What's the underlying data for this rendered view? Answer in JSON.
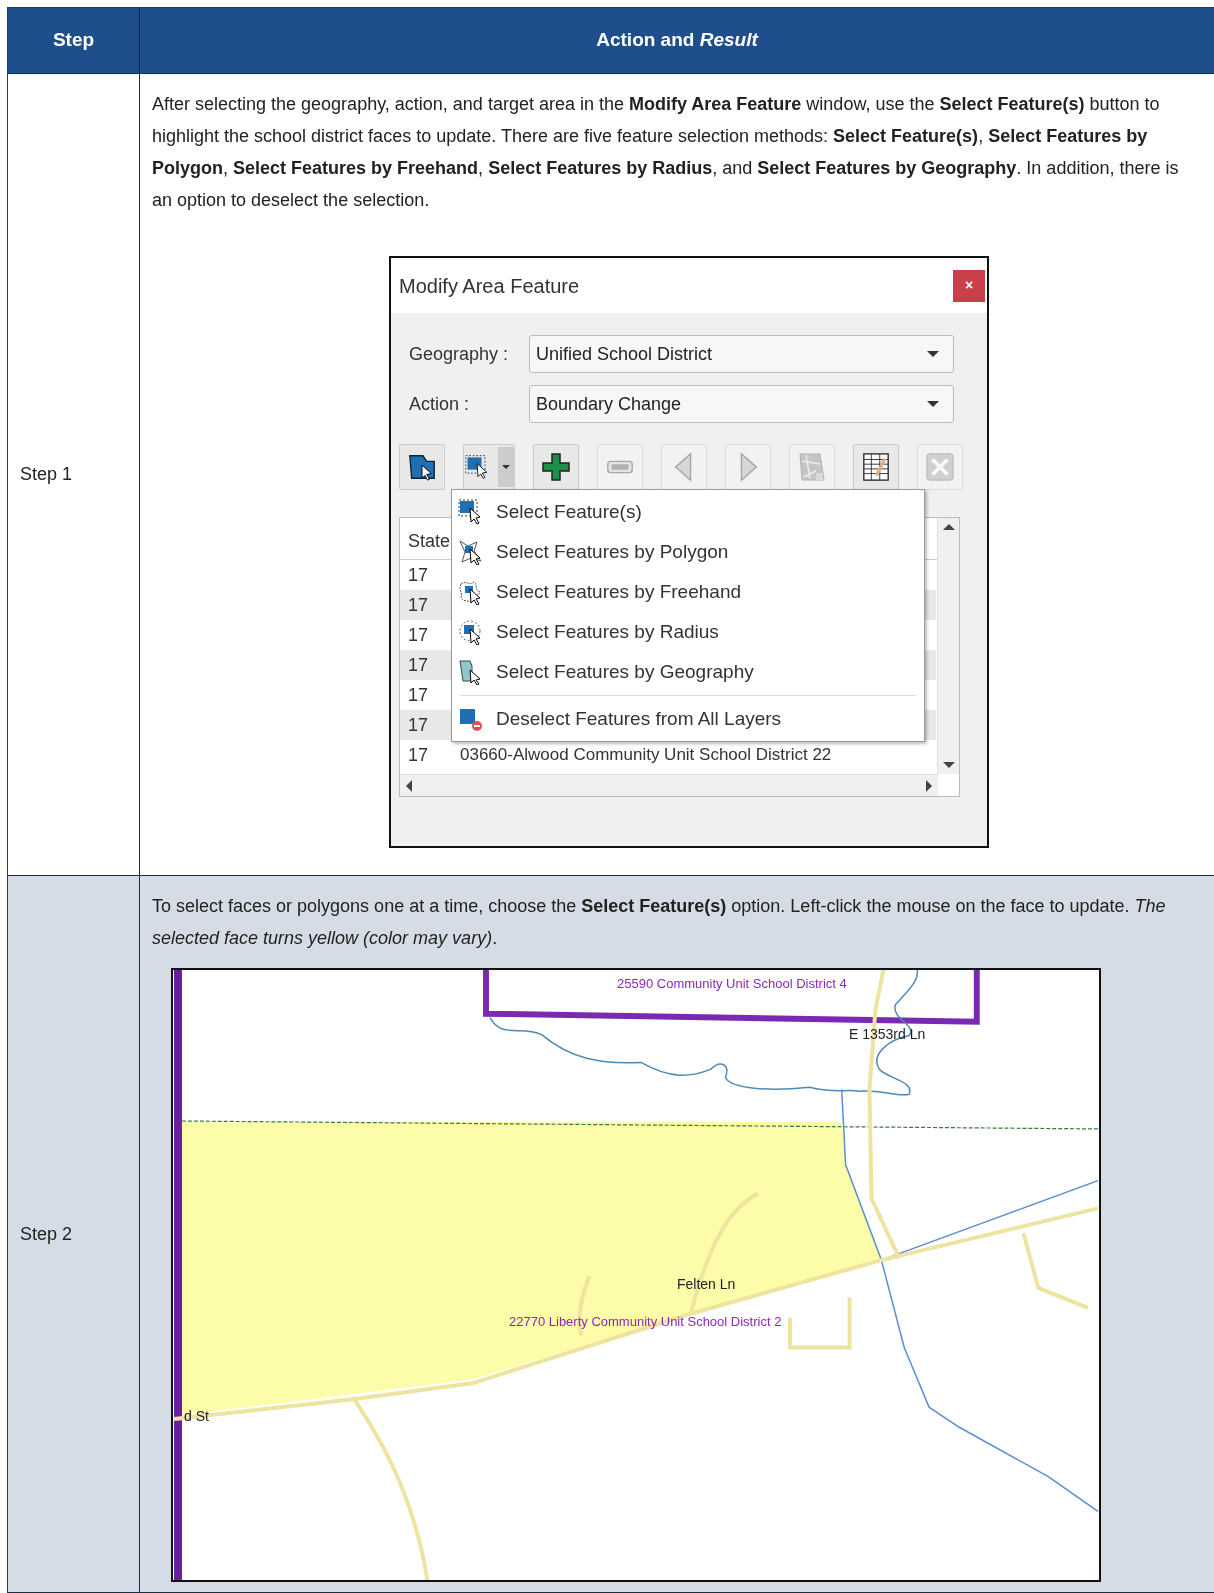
{
  "table": {
    "columns": [
      "Step",
      "Action and *Result*"
    ],
    "rows": [
      {
        "step": "Step 1",
        "text": "After selecting the geography, action, and target area in the **Modify Area Feature** window, use the **Select Feature(s)** button to highlight the school district faces to update. There are five feature selection methods: **Select Feature(s)**, **Select Features by Polygon**, **Select Features by Freehand**, **Select Features by Radius**, and **Select Features by Geography**. In addition, there is an option to deselect the selection.",
        "figure": {
          "kind": "dialog",
          "title": "Modify Area Feature",
          "close": "×",
          "fields": [
            {
              "label": "Geography :",
              "value": "Unified School District"
            },
            {
              "label": "Action :",
              "value": "Boundary Change"
            }
          ],
          "toolbar": [
            {
              "kind": "geo",
              "disabled": false
            },
            {
              "kind": "select",
              "disabled": false
            },
            {
              "kind": "add",
              "disabled": false
            },
            {
              "kind": "remove",
              "disabled": true
            },
            {
              "kind": "prev",
              "disabled": true
            },
            {
              "kind": "next",
              "disabled": true
            },
            {
              "kind": "map",
              "disabled": true
            },
            {
              "kind": "table",
              "disabled": false
            },
            {
              "kind": "clear",
              "disabled": true
            }
          ],
          "menu": [
            {
              "kind": "select",
              "label": "Select Feature(s)"
            },
            {
              "kind": "polygon",
              "label": "Select Features by Polygon"
            },
            {
              "kind": "freehand",
              "label": "Select Features by Freehand"
            },
            {
              "kind": "radius",
              "label": "Select Features by Radius"
            },
            {
              "kind": "geography",
              "label": "Select Features by Geography"
            },
            {
              "kind": "deselect",
              "label": "Deselect Features from All Layers"
            }
          ],
          "grid": {
            "column_1": "State",
            "rows": [
              {
                "column_1": "17"
              },
              {
                "column_1": "17"
              },
              {
                "column_1": "17"
              },
              {
                "column_1": "17"
              },
              {
                "column_1": "17"
              },
              {
                "column_1": "17"
              },
              {
                "column_1": "17",
                "column_2": "03660-Alwood Community Unit School District 22"
              }
            ]
          }
        }
      },
      {
        "step": "Step 2",
        "text": "To select faces or polygons one at a time, choose the **Select Feature(s)** option. Left-click the mouse on the face to update. *The selected face turns yellow (color may vary)*.",
        "figure": {
          "kind": "map",
          "labels": [
            {
              "kind": "district",
              "text": "25590 Community Unit School District 4"
            },
            {
              "kind": "road",
              "text": "E 1353rd Ln"
            },
            {
              "kind": "road",
              "text": "Felten Ln"
            },
            {
              "kind": "district",
              "text": "22770 Liberty Community Unit School District 2"
            },
            {
              "kind": "road",
              "text": "d St"
            }
          ]
        }
      }
    ]
  }
}
